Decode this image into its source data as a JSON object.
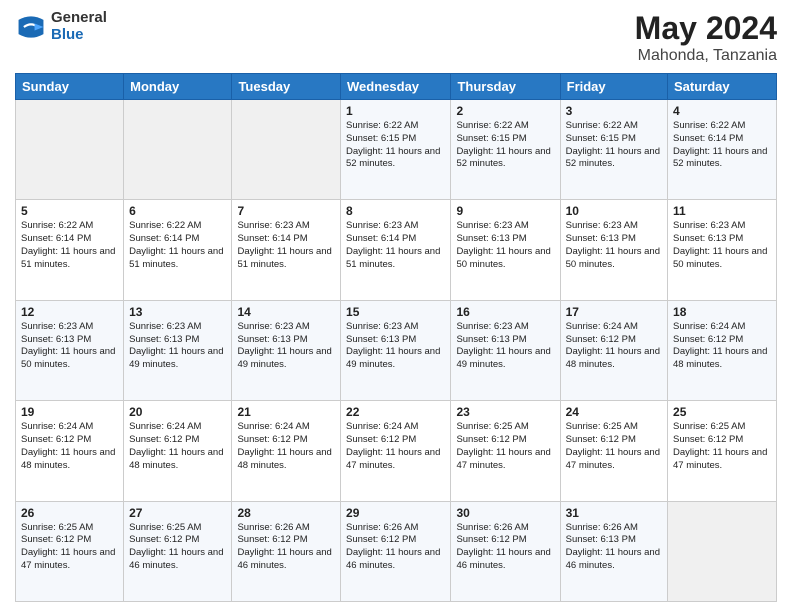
{
  "header": {
    "logo_general": "General",
    "logo_blue": "Blue",
    "title": "May 2024",
    "location": "Mahonda, Tanzania"
  },
  "days_of_week": [
    "Sunday",
    "Monday",
    "Tuesday",
    "Wednesday",
    "Thursday",
    "Friday",
    "Saturday"
  ],
  "weeks": [
    [
      {
        "day": "",
        "info": ""
      },
      {
        "day": "",
        "info": ""
      },
      {
        "day": "",
        "info": ""
      },
      {
        "day": "1",
        "info": "Sunrise: 6:22 AM\nSunset: 6:15 PM\nDaylight: 11 hours and 52 minutes."
      },
      {
        "day": "2",
        "info": "Sunrise: 6:22 AM\nSunset: 6:15 PM\nDaylight: 11 hours and 52 minutes."
      },
      {
        "day": "3",
        "info": "Sunrise: 6:22 AM\nSunset: 6:15 PM\nDaylight: 11 hours and 52 minutes."
      },
      {
        "day": "4",
        "info": "Sunrise: 6:22 AM\nSunset: 6:14 PM\nDaylight: 11 hours and 52 minutes."
      }
    ],
    [
      {
        "day": "5",
        "info": "Sunrise: 6:22 AM\nSunset: 6:14 PM\nDaylight: 11 hours and 51 minutes."
      },
      {
        "day": "6",
        "info": "Sunrise: 6:22 AM\nSunset: 6:14 PM\nDaylight: 11 hours and 51 minutes."
      },
      {
        "day": "7",
        "info": "Sunrise: 6:23 AM\nSunset: 6:14 PM\nDaylight: 11 hours and 51 minutes."
      },
      {
        "day": "8",
        "info": "Sunrise: 6:23 AM\nSunset: 6:14 PM\nDaylight: 11 hours and 51 minutes."
      },
      {
        "day": "9",
        "info": "Sunrise: 6:23 AM\nSunset: 6:13 PM\nDaylight: 11 hours and 50 minutes."
      },
      {
        "day": "10",
        "info": "Sunrise: 6:23 AM\nSunset: 6:13 PM\nDaylight: 11 hours and 50 minutes."
      },
      {
        "day": "11",
        "info": "Sunrise: 6:23 AM\nSunset: 6:13 PM\nDaylight: 11 hours and 50 minutes."
      }
    ],
    [
      {
        "day": "12",
        "info": "Sunrise: 6:23 AM\nSunset: 6:13 PM\nDaylight: 11 hours and 50 minutes."
      },
      {
        "day": "13",
        "info": "Sunrise: 6:23 AM\nSunset: 6:13 PM\nDaylight: 11 hours and 49 minutes."
      },
      {
        "day": "14",
        "info": "Sunrise: 6:23 AM\nSunset: 6:13 PM\nDaylight: 11 hours and 49 minutes."
      },
      {
        "day": "15",
        "info": "Sunrise: 6:23 AM\nSunset: 6:13 PM\nDaylight: 11 hours and 49 minutes."
      },
      {
        "day": "16",
        "info": "Sunrise: 6:23 AM\nSunset: 6:13 PM\nDaylight: 11 hours and 49 minutes."
      },
      {
        "day": "17",
        "info": "Sunrise: 6:24 AM\nSunset: 6:12 PM\nDaylight: 11 hours and 48 minutes."
      },
      {
        "day": "18",
        "info": "Sunrise: 6:24 AM\nSunset: 6:12 PM\nDaylight: 11 hours and 48 minutes."
      }
    ],
    [
      {
        "day": "19",
        "info": "Sunrise: 6:24 AM\nSunset: 6:12 PM\nDaylight: 11 hours and 48 minutes."
      },
      {
        "day": "20",
        "info": "Sunrise: 6:24 AM\nSunset: 6:12 PM\nDaylight: 11 hours and 48 minutes."
      },
      {
        "day": "21",
        "info": "Sunrise: 6:24 AM\nSunset: 6:12 PM\nDaylight: 11 hours and 48 minutes."
      },
      {
        "day": "22",
        "info": "Sunrise: 6:24 AM\nSunset: 6:12 PM\nDaylight: 11 hours and 47 minutes."
      },
      {
        "day": "23",
        "info": "Sunrise: 6:25 AM\nSunset: 6:12 PM\nDaylight: 11 hours and 47 minutes."
      },
      {
        "day": "24",
        "info": "Sunrise: 6:25 AM\nSunset: 6:12 PM\nDaylight: 11 hours and 47 minutes."
      },
      {
        "day": "25",
        "info": "Sunrise: 6:25 AM\nSunset: 6:12 PM\nDaylight: 11 hours and 47 minutes."
      }
    ],
    [
      {
        "day": "26",
        "info": "Sunrise: 6:25 AM\nSunset: 6:12 PM\nDaylight: 11 hours and 47 minutes."
      },
      {
        "day": "27",
        "info": "Sunrise: 6:25 AM\nSunset: 6:12 PM\nDaylight: 11 hours and 46 minutes."
      },
      {
        "day": "28",
        "info": "Sunrise: 6:26 AM\nSunset: 6:12 PM\nDaylight: 11 hours and 46 minutes."
      },
      {
        "day": "29",
        "info": "Sunrise: 6:26 AM\nSunset: 6:12 PM\nDaylight: 11 hours and 46 minutes."
      },
      {
        "day": "30",
        "info": "Sunrise: 6:26 AM\nSunset: 6:12 PM\nDaylight: 11 hours and 46 minutes."
      },
      {
        "day": "31",
        "info": "Sunrise: 6:26 AM\nSunset: 6:13 PM\nDaylight: 11 hours and 46 minutes."
      },
      {
        "day": "",
        "info": ""
      }
    ]
  ]
}
